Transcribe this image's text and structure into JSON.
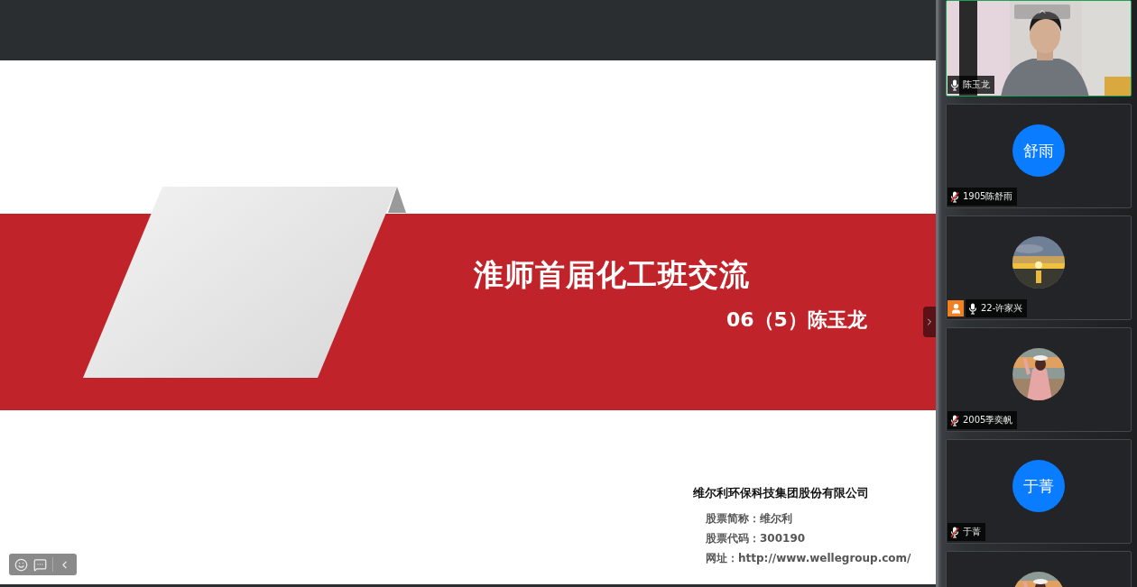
{
  "slide": {
    "title": "淮师首届化工班交流",
    "subtitle": "06（5）陈玉龙",
    "company": "维尔利环保科技集团股份有限公司",
    "details": [
      "股票简称：维尔利",
      "股票代码：300190",
      "网址：http://www.wellegroup.com/"
    ]
  },
  "participants": [
    {
      "kind": "video",
      "name": "陈玉龙",
      "muted": false,
      "active": true,
      "host": false
    },
    {
      "kind": "initials",
      "initials": "舒雨",
      "name": "1905陈舒雨",
      "muted": true,
      "active": false,
      "host": false
    },
    {
      "kind": "picture",
      "name": "22-许家兴",
      "muted": false,
      "active": false,
      "host": true
    },
    {
      "kind": "picture",
      "name": "2005季奕帆",
      "muted": true,
      "active": false,
      "host": false
    },
    {
      "kind": "initials",
      "initials": "于菁",
      "name": "于菁",
      "muted": true,
      "active": false,
      "host": false
    },
    {
      "kind": "picture",
      "active": false
    }
  ]
}
